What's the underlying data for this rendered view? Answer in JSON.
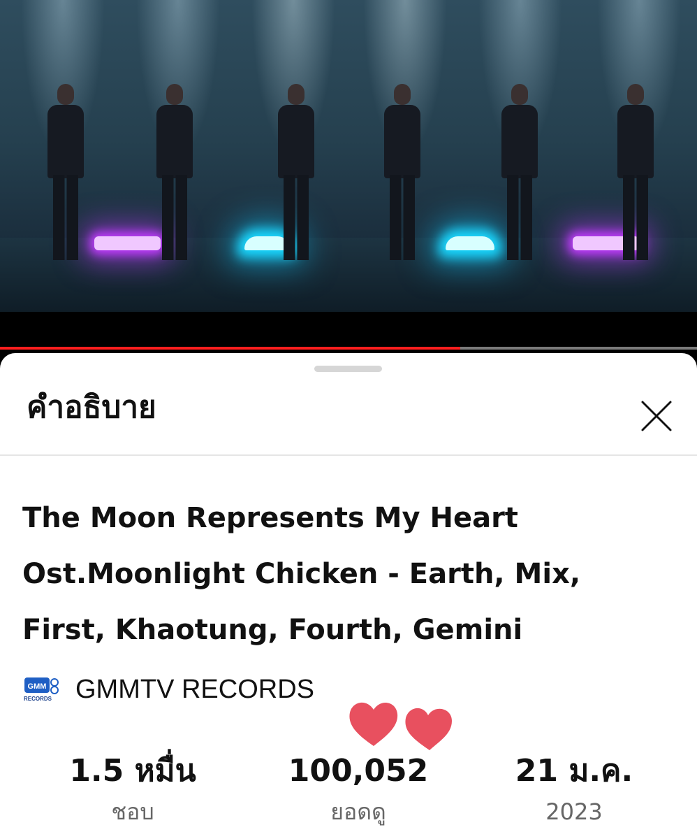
{
  "video": {
    "progress_fraction": 0.66
  },
  "sheet": {
    "title": "คำอธิบาย",
    "close_icon": "close-icon"
  },
  "description": {
    "title_lines": [
      "The Moon Represents My Heart",
      "Ost.Moonlight Chicken - Earth, Mix,",
      "First, Khaotung, Fourth, Gemini"
    ],
    "channel": {
      "name": "GMMTV RECORDS",
      "logo_text_top": "GMM",
      "logo_text_bottom": "RECORDS"
    }
  },
  "stats": [
    {
      "value": "1.5 หมื่น",
      "label": "ชอบ"
    },
    {
      "value": "100,052",
      "label": "ยอดดู"
    },
    {
      "value": "21 ม.ค.",
      "label": "2023"
    }
  ],
  "colors": {
    "progress": "#ff1e1e",
    "hearts": "#e8505f",
    "logo_blue": "#1f5fc4"
  }
}
